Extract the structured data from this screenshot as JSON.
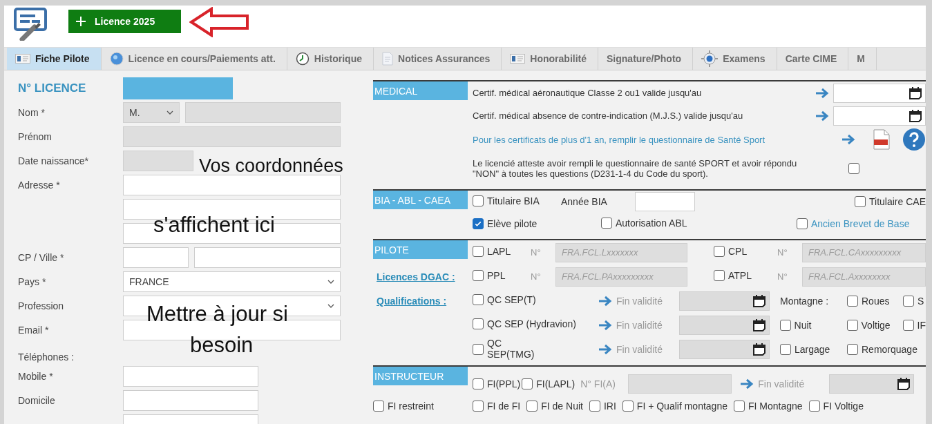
{
  "header": {
    "new_licence_button": "Licence 2025"
  },
  "tabs": [
    {
      "label": "Fiche Pilote",
      "selected": true,
      "kind": "card"
    },
    {
      "label": "Licence en cours/Paiements att.",
      "selected": false,
      "kind": "globe"
    },
    {
      "label": "Historique",
      "selected": false,
      "kind": "clock"
    },
    {
      "label": "Notices Assurances",
      "selected": false,
      "kind": "document"
    },
    {
      "label": "Honorabilité",
      "selected": false,
      "kind": "card"
    },
    {
      "label": "Signature/Photo",
      "selected": false
    },
    {
      "label": "Examens",
      "selected": false,
      "kind": "target"
    },
    {
      "label": "Carte CIME",
      "selected": false
    },
    {
      "label": "M",
      "selected": false
    }
  ],
  "identity": {
    "rows": [
      {
        "kind": "licence",
        "label": "N° LICENCE"
      },
      {
        "kind": "civility",
        "label": "Nom *",
        "value": "M."
      },
      {
        "kind": "locked",
        "label": "Prénom"
      },
      {
        "kind": "locked_short",
        "label": "Date naissance*"
      },
      {
        "kind": "text",
        "label": "Adresse *"
      },
      {
        "kind": "text"
      },
      {
        "kind": "text"
      },
      {
        "kind": "split",
        "label": "CP / Ville *"
      },
      {
        "kind": "select",
        "label": "Pays *",
        "value": "FRANCE"
      },
      {
        "kind": "select",
        "label": "Profession"
      },
      {
        "kind": "text",
        "label": "Email *"
      },
      {
        "kind": "heading",
        "label": "Téléphones :"
      },
      {
        "kind": "short",
        "label": "Mobile *"
      },
      {
        "kind": "short",
        "label": "Domicile"
      },
      {
        "kind": "short"
      }
    ]
  },
  "annotations": [
    "Vos coordonnées",
    "s'affichent ici",
    "Mettre à jour si",
    "besoin"
  ],
  "medical": {
    "title": "MEDICAL",
    "rows": [
      {
        "kind": "date",
        "text": "Certif. médical aéronautique Classe 2 ou1 valide jusqu'au"
      },
      {
        "kind": "date",
        "text": "Certif. médical absence de contre-indication (M.J.S.) valide jusqu'au"
      },
      {
        "kind": "link",
        "text": "Pour les certificats de plus d'1 an, remplir le questionnaire de Santé Sport"
      },
      {
        "kind": "check",
        "text": "Le licencié atteste avoir rempli le questionnaire de santé SPORT et avoir répondu \"NON\" à toutes les questions (D231-1-4 du Code du sport).",
        "checked": false
      }
    ]
  },
  "bia": {
    "title": "BIA - ABL - CAEA",
    "titulaire_bia": {
      "label": "Titulaire BIA",
      "checked": false
    },
    "annee_label": "Année BIA",
    "titulaire_caea": {
      "label": "Titulaire CAE",
      "checked": false
    },
    "eleve_pilote": {
      "label": "Elève pilote",
      "checked": true
    },
    "autorisation_abl": {
      "label": "Autorisation ABL",
      "checked": false
    },
    "ancien_brevet": {
      "label": "Ancien Brevet de Base",
      "checked": false
    }
  },
  "pilote": {
    "title": "PILOTE",
    "link": "Licences DGAC :",
    "licences": [
      {
        "label": "LAPL",
        "checked": false,
        "number_label": "N°",
        "placeholder": "FRA.FCL.Lxxxxxxx"
      },
      {
        "label": "CPL",
        "checked": false,
        "number_label": "N°",
        "placeholder": "FRA.FCL.CAxxxxxxxxx"
      },
      {
        "label": "PPL",
        "checked": false,
        "number_label": "N°",
        "placeholder": "FRA.FCL.PAxxxxxxxxx"
      },
      {
        "label": "ATPL",
        "checked": false,
        "number_label": "N°",
        "placeholder": "FRA.FCL.Axxxxxxxx"
      }
    ]
  },
  "qualifications": {
    "link": "Qualifications :",
    "rows": [
      {
        "label": "QC SEP(T)",
        "checked": false,
        "validity_label": "Fin validité",
        "extras_label": "Montagne :",
        "extras": [
          {
            "label": "Roues",
            "checked": false
          },
          {
            "label": "S",
            "checked": false
          }
        ]
      },
      {
        "label": "QC SEP (Hydravion)",
        "checked": false,
        "validity_label": "Fin validité",
        "extras": [
          {
            "label": "Nuit",
            "checked": false
          },
          {
            "label": "Voltige",
            "checked": false
          },
          {
            "label": "IF",
            "checked": false
          }
        ]
      },
      {
        "label": "QC SEP(TMG)",
        "checked": false,
        "validity_label": "Fin validité",
        "extras": [
          {
            "label": "Largage",
            "checked": false
          },
          {
            "label": "Remorquage",
            "checked": false
          }
        ]
      }
    ]
  },
  "instructeur": {
    "title": "INSTRUCTEUR",
    "checks": [
      {
        "label": "FI(PPL)",
        "checked": false
      },
      {
        "label": "FI(LAPL)",
        "checked": false
      }
    ],
    "number_label": "N° FI(A)",
    "validity_label": "Fin validité",
    "options": [
      {
        "label": "FI restreint",
        "checked": false
      },
      {
        "label": "FI de FI",
        "checked": false
      },
      {
        "label": "FI de Nuit",
        "checked": false
      },
      {
        "label": "IRI",
        "checked": false
      },
      {
        "label": "FI + Qualif montagne",
        "checked": false
      },
      {
        "label": "FI Montagne",
        "checked": false
      },
      {
        "label": "FI Voltige",
        "checked": false
      }
    ]
  }
}
